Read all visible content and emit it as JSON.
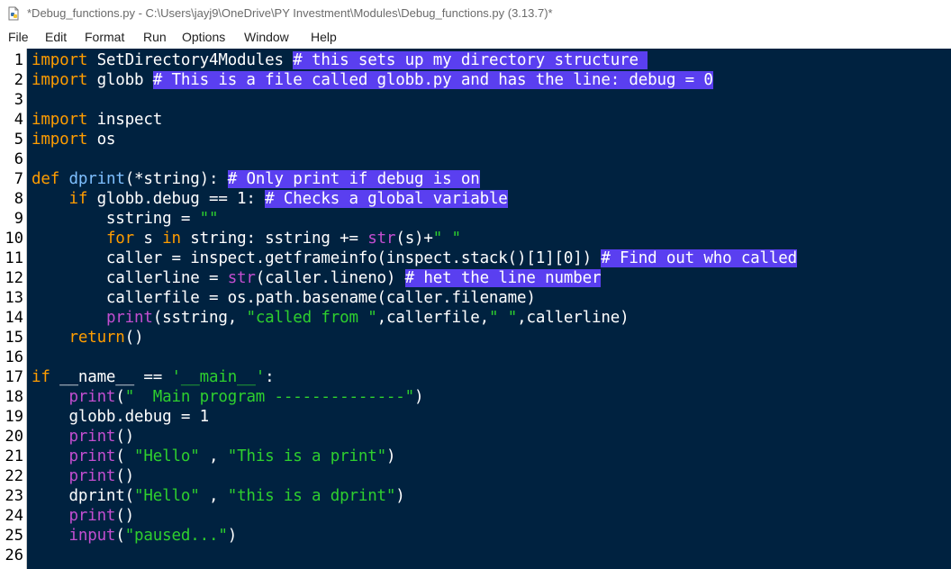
{
  "window": {
    "title": "*Debug_functions.py - C:\\Users\\jayj9\\OneDrive\\PY Investment\\Modules\\Debug_functions.py (3.13.7)*",
    "icon": "python-file-icon"
  },
  "menu": [
    {
      "label": "File"
    },
    {
      "label": "Edit"
    },
    {
      "label": "Format"
    },
    {
      "label": "Run"
    },
    {
      "label": "Options"
    },
    {
      "label": "Window"
    },
    {
      "label": "Help"
    }
  ],
  "colors": {
    "editor_bg": "#002240",
    "keyword": "#ff9d00",
    "builtin": "#c34ed0",
    "string": "#2ecf2e",
    "definition": "#7fc0ff",
    "comment_highlight": "#5a3ff0"
  },
  "code": {
    "line_numbers": [
      "1",
      "2",
      "3",
      "4",
      "5",
      "6",
      "7",
      "8",
      "9",
      "10",
      "11",
      "12",
      "13",
      "14",
      "15",
      "16",
      "17",
      "18",
      "19",
      "20",
      "21",
      "22",
      "23",
      "24",
      "25",
      "26"
    ],
    "lines": [
      [
        [
          "kw",
          "import"
        ],
        [
          "n",
          " SetDirectory4Modules "
        ],
        [
          "cm",
          "# this sets up my directory structure "
        ]
      ],
      [
        [
          "kw",
          "import"
        ],
        [
          "n",
          " globb "
        ],
        [
          "cm",
          "# This is a file called globb.py and has the line: debug = 0"
        ]
      ],
      [],
      [
        [
          "kw",
          "import"
        ],
        [
          "n",
          " inspect"
        ]
      ],
      [
        [
          "kw",
          "import"
        ],
        [
          "n",
          " os"
        ]
      ],
      [],
      [
        [
          "kw",
          "def"
        ],
        [
          "n",
          " "
        ],
        [
          "def",
          "dprint"
        ],
        [
          "n",
          "(*string): "
        ],
        [
          "cm",
          "# Only print if debug is on"
        ]
      ],
      [
        [
          "n",
          "    "
        ],
        [
          "kw",
          "if"
        ],
        [
          "n",
          " globb.debug == 1: "
        ],
        [
          "cm",
          "# Checks a global variable"
        ]
      ],
      [
        [
          "n",
          "        sstring = "
        ],
        [
          "str",
          "\"\""
        ]
      ],
      [
        [
          "n",
          "        "
        ],
        [
          "kw",
          "for"
        ],
        [
          "n",
          " s "
        ],
        [
          "kw",
          "in"
        ],
        [
          "n",
          " string: sstring += "
        ],
        [
          "bi",
          "str"
        ],
        [
          "n",
          "(s)+"
        ],
        [
          "str",
          "\" \""
        ]
      ],
      [
        [
          "n",
          "        caller = inspect.getframeinfo(inspect.stack()[1][0]) "
        ],
        [
          "cm",
          "# Find out who called"
        ]
      ],
      [
        [
          "n",
          "        callerline = "
        ],
        [
          "bi",
          "str"
        ],
        [
          "n",
          "(caller.lineno) "
        ],
        [
          "cm",
          "# het the line number"
        ]
      ],
      [
        [
          "n",
          "        callerfile = os.path.basename(caller.filename)"
        ]
      ],
      [
        [
          "n",
          "        "
        ],
        [
          "bi",
          "print"
        ],
        [
          "n",
          "(sstring, "
        ],
        [
          "str",
          "\"called from \""
        ],
        [
          "n",
          ",callerfile,"
        ],
        [
          "str",
          "\" \""
        ],
        [
          "n",
          ",callerline)"
        ]
      ],
      [
        [
          "n",
          "    "
        ],
        [
          "kw",
          "return"
        ],
        [
          "n",
          "()"
        ]
      ],
      [],
      [
        [
          "kw",
          "if"
        ],
        [
          "n",
          " __name__ == "
        ],
        [
          "str",
          "'__main__'"
        ],
        [
          "n",
          ":"
        ]
      ],
      [
        [
          "n",
          "    "
        ],
        [
          "bi",
          "print"
        ],
        [
          "n",
          "("
        ],
        [
          "str",
          "\"  Main program --------------\""
        ],
        [
          "n",
          ")"
        ]
      ],
      [
        [
          "n",
          "    globb.debug = 1"
        ]
      ],
      [
        [
          "n",
          "    "
        ],
        [
          "bi",
          "print"
        ],
        [
          "n",
          "()"
        ]
      ],
      [
        [
          "n",
          "    "
        ],
        [
          "bi",
          "print"
        ],
        [
          "n",
          "( "
        ],
        [
          "str",
          "\"Hello\""
        ],
        [
          "n",
          " , "
        ],
        [
          "str",
          "\"This is a print\""
        ],
        [
          "n",
          ")"
        ]
      ],
      [
        [
          "n",
          "    "
        ],
        [
          "bi",
          "print"
        ],
        [
          "n",
          "()"
        ]
      ],
      [
        [
          "n",
          "    dprint("
        ],
        [
          "str",
          "\"Hello\""
        ],
        [
          "n",
          " , "
        ],
        [
          "str",
          "\"this is a dprint\""
        ],
        [
          "n",
          ")"
        ]
      ],
      [
        [
          "n",
          "    "
        ],
        [
          "bi",
          "print"
        ],
        [
          "n",
          "()"
        ]
      ],
      [
        [
          "n",
          "    "
        ],
        [
          "bi",
          "input"
        ],
        [
          "n",
          "("
        ],
        [
          "str",
          "\"paused...\""
        ],
        [
          "n",
          ")"
        ]
      ],
      []
    ]
  }
}
